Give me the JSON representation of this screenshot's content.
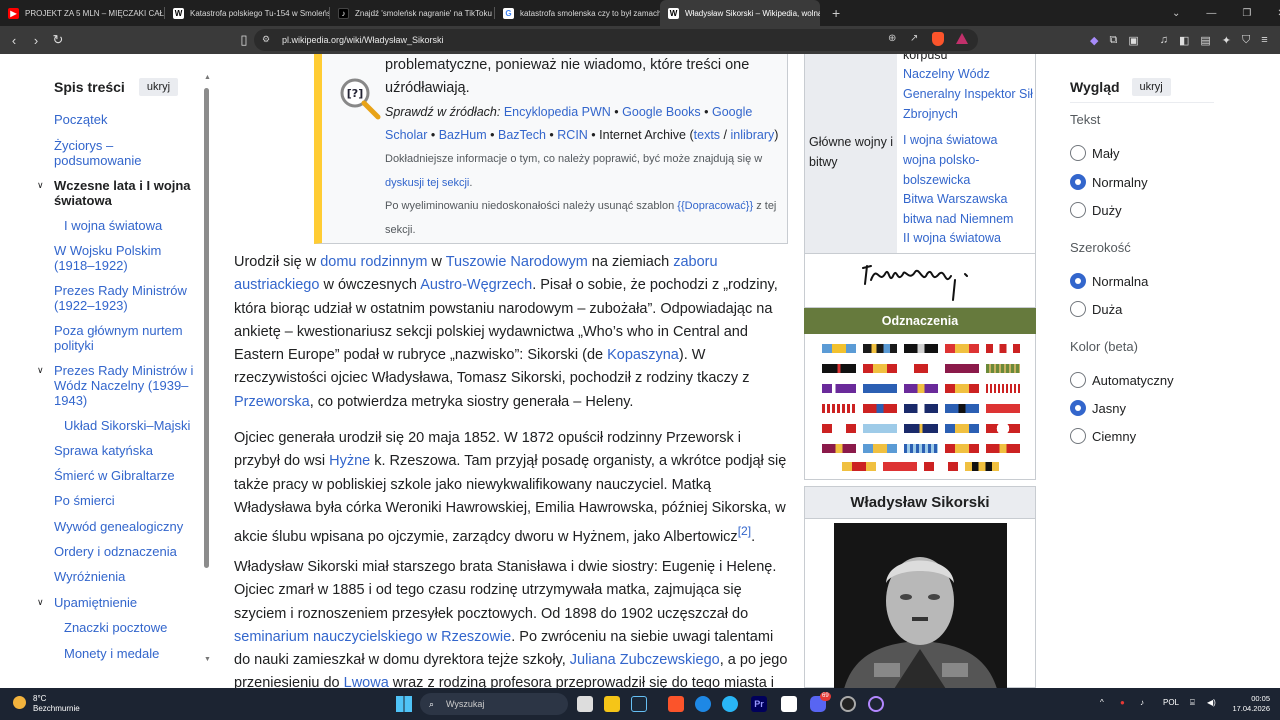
{
  "browser": {
    "tabs": [
      {
        "title": "PROJEKT ZA 5 MLN – MIĘCZAKI CAŁY",
        "icon": "youtube-icon",
        "color": "#ff0000"
      },
      {
        "title": "Katastrofa polskiego Tu-154 w Smoleńsku",
        "icon": "wikipedia-icon",
        "color": "#ffffff"
      },
      {
        "title": "Znajdź 'smoleńsk nagranie' na TikToku",
        "icon": "tiktok-icon",
        "color": "#000000"
      },
      {
        "title": "katastrofa smolenska czy to był zamach",
        "icon": "google-icon",
        "color": "#ffffff"
      },
      {
        "title": "Władysław Sikorski – Wikipedia, wolna",
        "icon": "wikipedia-icon",
        "color": "#ffffff"
      }
    ],
    "url": "pl.wikipedia.org/wiki/Władysław_Sikorski"
  },
  "toc": {
    "title": "Spis treści",
    "hide_label": "ukryj",
    "items": [
      {
        "label": "Początek"
      },
      {
        "label": "Życiorys – podsumowanie"
      },
      {
        "label": "Wczesne lata i I wojna światowa"
      },
      {
        "label": "I wojna światowa"
      },
      {
        "label": "W Wojsku Polskim (1918–1922)"
      },
      {
        "label": "Prezes Rady Ministrów (1922–1923)"
      },
      {
        "label": "Poza głównym nurtem polityki"
      },
      {
        "label": "Prezes Rady Ministrów i Wódz Naczelny (1939–1943)"
      },
      {
        "label": "Układ Sikorski–Majski"
      },
      {
        "label": "Sprawa katyńska"
      },
      {
        "label": "Śmierć w Gibraltarze"
      },
      {
        "label": "Po śmierci"
      },
      {
        "label": "Wywód genealogiczny"
      },
      {
        "label": "Ordery i odznaczenia"
      },
      {
        "label": "Wyróżnienia"
      },
      {
        "label": "Upamiętnienie"
      },
      {
        "label": "Znaczki pocztowe"
      },
      {
        "label": "Monety i medale"
      }
    ]
  },
  "notice": {
    "line1": "problematyczne, ponieważ nie wiadomo, które treści one uźródławiają.",
    "check_label": "Sprawdź w źródłach:",
    "sources": [
      "Encyklopedia PWN",
      "Google Books",
      "Google Scholar",
      "BazHum",
      "BazTech",
      "RCIN"
    ],
    "archive_label": "Internet Archive",
    "archive_links": [
      "texts",
      "inlibrary"
    ],
    "details_text": "Dokładniejsze informacje o tym, co należy poprawić, być może znajdują się w",
    "details_link": "dyskusji tej sekcji",
    "remove_text": "Po wyeliminowaniu niedoskonałości należy usunąć szablon",
    "template_name": "{{Dopracować}}",
    "remove_tail": "z tej sekcji."
  },
  "article": {
    "p1": {
      "a": "Urodził się w ",
      "l1": "domu rodzinnym",
      "b": " w ",
      "l2": "Tuszowie Narodowym",
      "c": " na ziemiach ",
      "l3": "zaboru austriackiego",
      "d": " w ówczesnych ",
      "l4": "Austro-Węgrzech",
      "e": ". Pisał o sobie, że pochodzi z „rodziny, która biorąc udział w ostatnim powstaniu narodowym – zubożała”. Odpowiadając na ankietę – kwestionariusz sekcji polskiej wydawnictwa „Who’s who in Central and Eastern Europe” podał w rubryce „nazwisko”: Sikorski (de ",
      "l5": "Kopaszyna",
      "f": "). W rzeczywistości ojciec Władysława, Tomasz Sikorski, pochodził z rodziny tkaczy z ",
      "l6": "Przeworska",
      "g": ", co potwierdza metryka siostry generała – Heleny."
    },
    "p2": {
      "a": "Ojciec generała urodził się 20 maja 1852. W 1872 opuścił rodzinny Przeworsk i przybył do wsi ",
      "l1": "Hyżne",
      "b": " k. Rzeszowa. Tam przyjął posadę organisty, a wkrótce podjął się także pracy w pobliskiej szkole jako niewykwalifikowany nauczyciel. Matką Władysława była córka Weroniki Hawrowskiej, Emilia Hawrowska, później Sikorska, w akcie ślubu wpisana po ojczymie, zarządcy dworu w Hyżnem, jako Albertowicz",
      "ref": "[2]",
      "c": "."
    },
    "p3": {
      "a": "Władysław Sikorski miał starszego brata Stanisława i dwie siostry: Eugenię i Helenę. Ojciec zmarł w 1885 i od tego czasu rodzinę utrzymywała matka, zajmująca się szyciem i roznoszeniem przesyłek pocztowych. Od 1898 do 1902 uczęszczał do ",
      "l1": "seminarium nauczycielskiego w Rzeszowie",
      "b": ". Po zwróceniu na siebie uwagi talentami do nauki zamieszkał w domu dyrektora tejże szkoły, ",
      "l2": "Juliana Zubczewskiego",
      "c": ", a po jego przeniesieniu do ",
      "l3": "Lwowa",
      "d": " wraz z rodziną profesora przeprowadził się do tego miasta i"
    }
  },
  "infobox": {
    "partial_top": "korpusu",
    "positions": [
      "Naczelny Wódz",
      "Generalny Inspektor Sił Zbrojnych"
    ],
    "wars_label": "Główne wojny i bitwy",
    "wars": [
      "I wojna światowa",
      "wojna polsko-bolszewicka",
      "Bitwa Warszawska",
      "bitwa nad Niemnem",
      "II wojna światowa"
    ],
    "decorations_header": "Odznaczenia",
    "name_header": "Władysław Sikorski"
  },
  "appearance": {
    "title": "Wygląd",
    "hide_label": "ukryj",
    "text_group": "Tekst",
    "text_options": [
      {
        "label": "Mały",
        "selected": false
      },
      {
        "label": "Normalny",
        "selected": true
      },
      {
        "label": "Duży",
        "selected": false
      }
    ],
    "width_group": "Szerokość",
    "width_options": [
      {
        "label": "Normalna",
        "selected": true
      },
      {
        "label": "Duża",
        "selected": false
      }
    ],
    "color_group": "Kolor (beta)",
    "color_options": [
      {
        "label": "Automatyczny",
        "selected": false
      },
      {
        "label": "Jasny",
        "selected": true
      },
      {
        "label": "Ciemny",
        "selected": false
      }
    ]
  },
  "taskbar": {
    "temperature": "8°C",
    "weather": "Bezchmurnie",
    "search_placeholder": "Wyszukaj",
    "lang": "POL",
    "time": "00:05",
    "date": "17.04.2026",
    "discord_badge": "69"
  }
}
